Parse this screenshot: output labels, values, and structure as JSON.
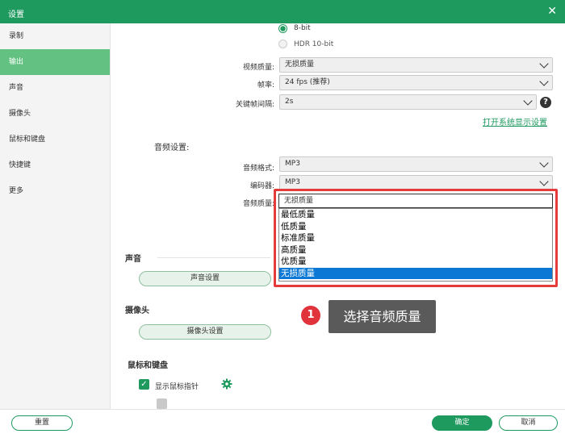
{
  "window": {
    "title": "设置",
    "close_glyph": "✕"
  },
  "sidebar": {
    "items": [
      {
        "label": "录制",
        "active": false
      },
      {
        "label": "输出",
        "active": true
      },
      {
        "label": "声音",
        "active": false
      },
      {
        "label": "摄像头",
        "active": false
      },
      {
        "label": "鼠标和键盘",
        "active": false
      },
      {
        "label": "快捷键",
        "active": false
      },
      {
        "label": "更多",
        "active": false
      }
    ]
  },
  "video": {
    "bitdepth_options": [
      {
        "label": "8-bit",
        "checked": true
      },
      {
        "label": "HDR 10-bit",
        "checked": false,
        "disabled": true
      }
    ],
    "quality_label": "视频质量:",
    "quality_value": "无损质量",
    "fps_label": "帧率:",
    "fps_value": "24 fps (推荐)",
    "keyframe_label": "关键帧间隔:",
    "keyframe_value": "2s",
    "help_glyph": "?",
    "system_display_link": "打开系统显示设置"
  },
  "audio": {
    "section_title": "音频设置:",
    "format_label": "音频格式:",
    "format_value": "MP3",
    "encoder_label": "编码器:",
    "encoder_value": "MP3",
    "quality_label": "音频质量:",
    "quality_value": "无损质量",
    "quality_options": [
      "最低质量",
      "低质量",
      "标准质量",
      "高质量",
      "优质量",
      "无损质量"
    ],
    "selected_index": 5
  },
  "sound": {
    "section_title": "声音",
    "button": "声音设置"
  },
  "camera": {
    "section_title": "摄像头",
    "button": "摄像头设置"
  },
  "mouse": {
    "section_title": "鼠标和键盘",
    "show_cursor_label": "显示鼠标指针",
    "check_glyph": "✓"
  },
  "tooltip": {
    "number": "1",
    "text": "选择音频质量"
  },
  "footer": {
    "reset": "重置",
    "ok": "确定",
    "cancel": "取消"
  },
  "colors": {
    "brand": "#1f9a5f",
    "sidebar_active": "#63c282",
    "highlight": "#e53b3b",
    "selection": "#0a78d4"
  }
}
